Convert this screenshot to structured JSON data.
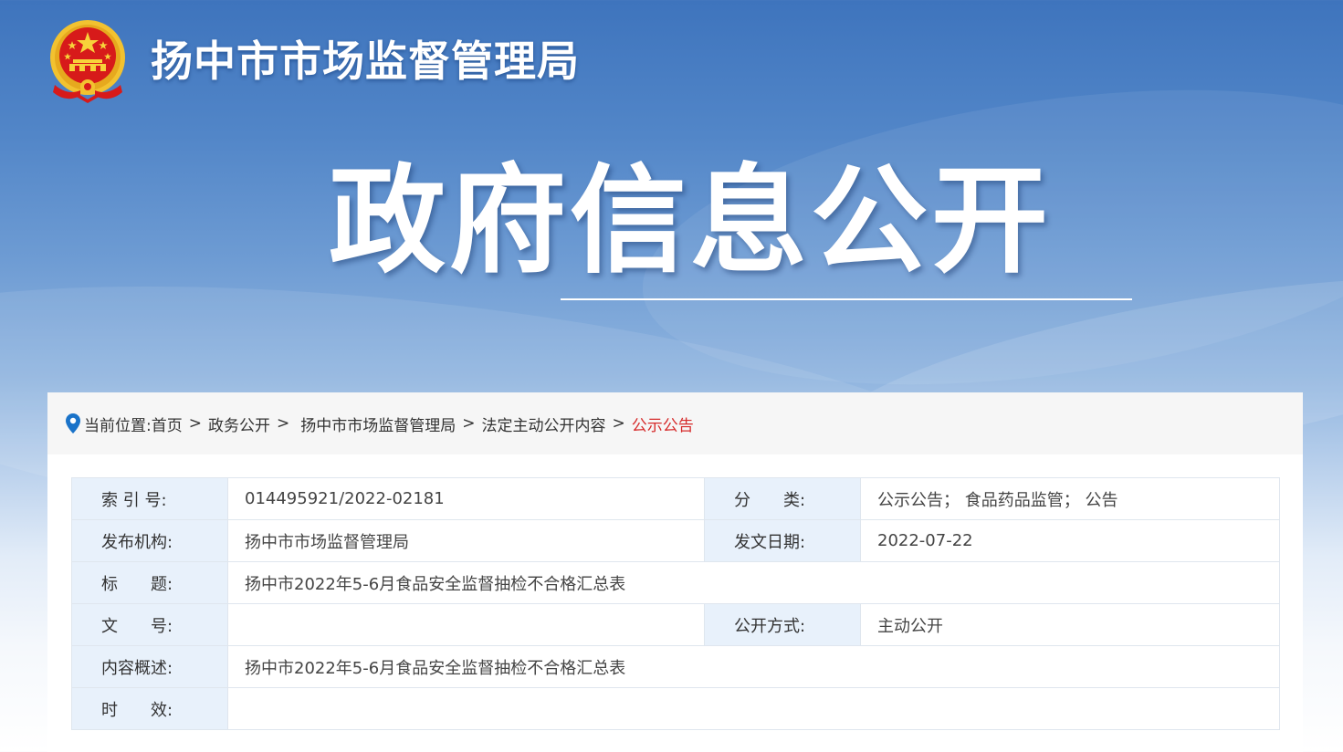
{
  "site": {
    "title": "扬中市市场监督管理局",
    "emblem_icon": "national-emblem-icon"
  },
  "hero": {
    "title": "政府信息公开"
  },
  "breadcrumb": {
    "prefix": "当前位置:",
    "items": [
      "首页",
      "政务公开",
      "扬中市市场监督管理局",
      "法定主动公开内容",
      "公示公告"
    ],
    "separator": ">",
    "current_color": "#d62b2b"
  },
  "info": {
    "index_label": "索 引 号:",
    "index_value": "014495921/2022-02181",
    "category_label": "分　　类:",
    "category_value": "公示公告； 食品药品监管； 公告",
    "publisher_label": "发布机构:",
    "publisher_value": "扬中市市场监督管理局",
    "date_label": "发文日期:",
    "date_value": "2022-07-22",
    "title_label": "标　　题:",
    "title_value": "扬中市2022年5-6月食品安全监督抽检不合格汇总表",
    "docno_label": "文　　号:",
    "docno_value": "",
    "mode_label": "公开方式:",
    "mode_value": "主动公开",
    "summary_label": "内容概述:",
    "summary_value": "扬中市2022年5-6月食品安全监督抽检不合格汇总表",
    "validity_label": "时　　效:",
    "validity_value": ""
  },
  "colors": {
    "banner_top": "#3e74bd",
    "label_bg": "#e8f1fb",
    "emblem_red": "#d71a1a",
    "emblem_gold": "#f2c230"
  }
}
